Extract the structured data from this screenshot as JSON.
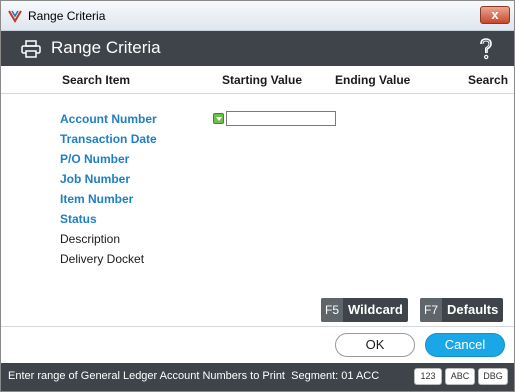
{
  "window": {
    "title": "Range Criteria",
    "close_label": "x"
  },
  "header": {
    "title": "Range Criteria"
  },
  "columns": {
    "search_item": "Search Item",
    "starting_value": "Starting Value",
    "ending_value": "Ending Value",
    "search": "Search"
  },
  "items": [
    {
      "label": "Account Number",
      "active": true
    },
    {
      "label": "Transaction Date",
      "active": true
    },
    {
      "label": "P/O Number",
      "active": true
    },
    {
      "label": "Job Number",
      "active": true
    },
    {
      "label": "Item Number",
      "active": true
    },
    {
      "label": "Status",
      "active": true
    },
    {
      "label": "Description",
      "active": false
    },
    {
      "label": "Delivery Docket",
      "active": false
    }
  ],
  "inputs": {
    "account_start_value": ""
  },
  "function_buttons": {
    "wildcard": {
      "key": "F5",
      "label": "Wildcard"
    },
    "defaults": {
      "key": "F7",
      "label": "Defaults"
    }
  },
  "buttons": {
    "ok": "OK",
    "cancel": "Cancel"
  },
  "status": {
    "message": "Enter range of General Ledger Account Numbers to Print",
    "segment": "Segment: 01 ACC",
    "badges": [
      "123",
      "ABC",
      "DBG"
    ]
  },
  "colors": {
    "accent": "#1aa7e8",
    "header_bg": "#3e4449",
    "active_item": "#1f7fc4"
  }
}
